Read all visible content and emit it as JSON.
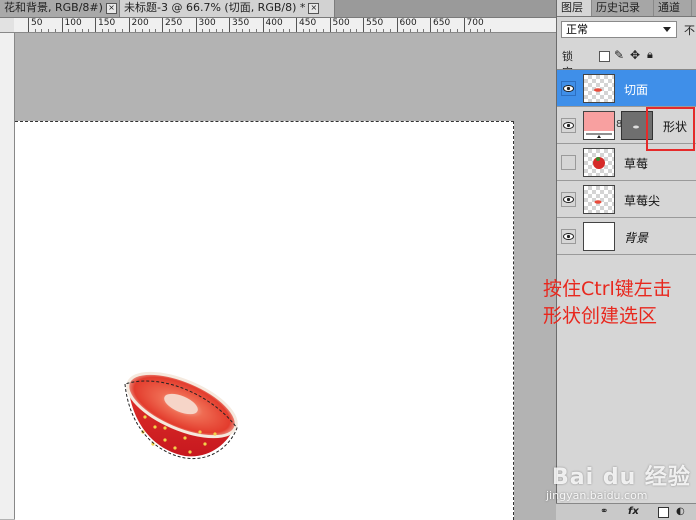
{
  "doc_tabs": [
    {
      "label": "花和背景, RGB/8#)",
      "active": false
    },
    {
      "label": "未标题-3 @ 66.7% (切面, RGB/8) *",
      "active": true
    }
  ],
  "ruler_labels": [
    "50",
    "100",
    "150",
    "200",
    "250",
    "300",
    "350",
    "400",
    "450",
    "500",
    "550",
    "600",
    "650",
    "700"
  ],
  "panel": {
    "tabs": [
      "图层",
      "历史记录",
      "通道"
    ],
    "blend_mode": "正常",
    "opacity_label": "不",
    "lock_label": "锁定:",
    "layers": [
      {
        "name": "切面",
        "selected": true,
        "visible": true,
        "thumb": "transparent"
      },
      {
        "name": "形状",
        "selected": false,
        "visible": true,
        "thumb": "pink",
        "has_mask": true
      },
      {
        "name": "草莓",
        "selected": false,
        "visible": false,
        "thumb": "transparent"
      },
      {
        "name": "草莓尖",
        "selected": false,
        "visible": true,
        "thumb": "transparent"
      },
      {
        "name": "背景",
        "selected": false,
        "visible": true,
        "thumb": "white",
        "italic": true
      }
    ],
    "bottom_icons": [
      "link-icon",
      "fx-icon",
      "mask-icon",
      "adjustment-icon"
    ],
    "fx_label": "fx"
  },
  "annotation": {
    "line1": "按住Ctrl键左击",
    "line2": "形状创建选区",
    "color": "#e8281e"
  },
  "watermark": {
    "brand": "Bai du 经验",
    "url": "jingyan.baidu.com"
  },
  "colors": {
    "selected_layer": "#3f8fe9",
    "highlight_box": "#e52a2a"
  }
}
